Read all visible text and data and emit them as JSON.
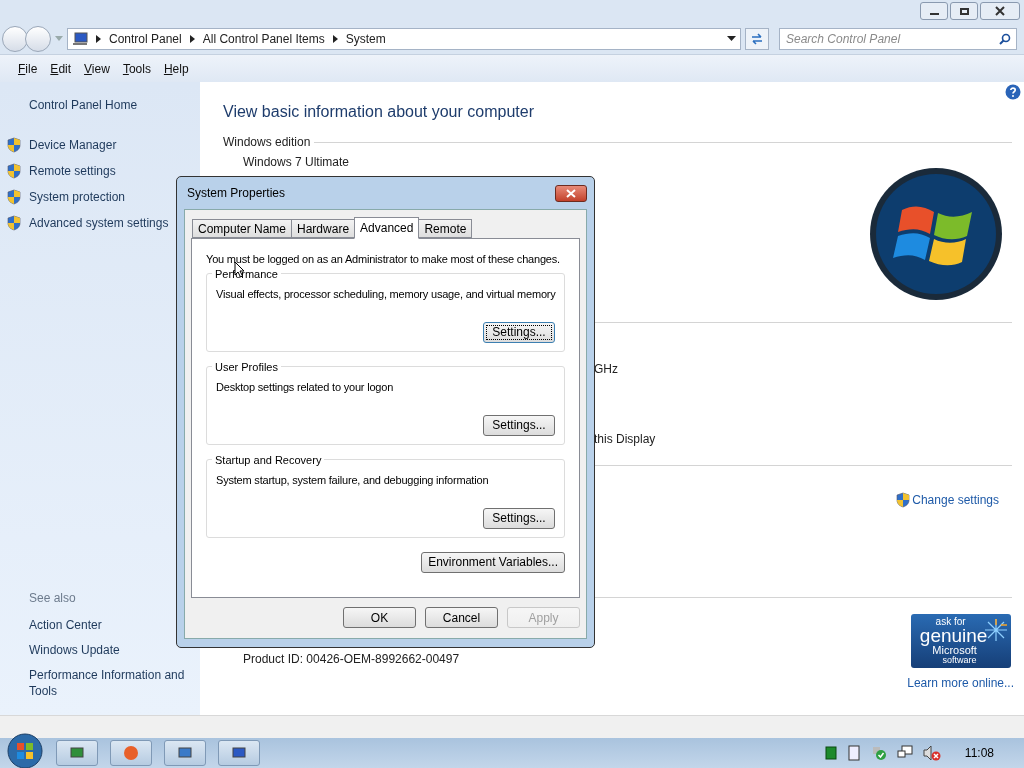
{
  "address": {
    "crumbs": [
      "Control Panel",
      "All Control Panel Items",
      "System"
    ],
    "search_placeholder": "Search Control Panel"
  },
  "menu": [
    "File",
    "Edit",
    "View",
    "Tools",
    "Help"
  ],
  "sidebar": {
    "home": "Control Panel Home",
    "tasks": [
      "Device Manager",
      "Remote settings",
      "System protection",
      "Advanced system settings"
    ],
    "see_also_title": "See also",
    "see_also": [
      "Action Center",
      "Windows Update",
      "Performance Information and Tools"
    ]
  },
  "content": {
    "heading": "View basic information about your computer",
    "section": "Windows edition",
    "edition": "Windows 7 Ultimate",
    "fragment_1": "GHz",
    "fragment_2": "this Display",
    "change_settings": "Change settings",
    "product_id": "Product ID: 00426-OEM-8992662-00497",
    "badge": [
      "ask for",
      "genuine",
      "Microsoft",
      "software"
    ],
    "learn_more": "Learn more online..."
  },
  "dialog": {
    "title": "System Properties",
    "tabs": [
      {
        "label": "Computer Name",
        "selected": false
      },
      {
        "label": "Hardware",
        "selected": false
      },
      {
        "label": "Advanced",
        "selected": true
      },
      {
        "label": "Remote",
        "selected": false
      }
    ],
    "notice": "You must be logged on as an Administrator to make most of these changes.",
    "groups": [
      {
        "title": "Performance",
        "description": "Visual effects, processor scheduling, memory usage, and virtual memory",
        "button": "Settings...",
        "focused": true
      },
      {
        "title": "User Profiles",
        "description": "Desktop settings related to your logon",
        "button": "Settings...",
        "focused": false
      },
      {
        "title": "Startup and Recovery",
        "description": "System startup, system failure, and debugging information",
        "button": "Settings...",
        "focused": false
      }
    ],
    "env_button": "Environment Variables...",
    "buttons": [
      {
        "label": "OK",
        "disabled": false
      },
      {
        "label": "Cancel",
        "disabled": false
      },
      {
        "label": "Apply",
        "disabled": true
      }
    ]
  },
  "taskbar": {
    "clock": "11:08"
  }
}
